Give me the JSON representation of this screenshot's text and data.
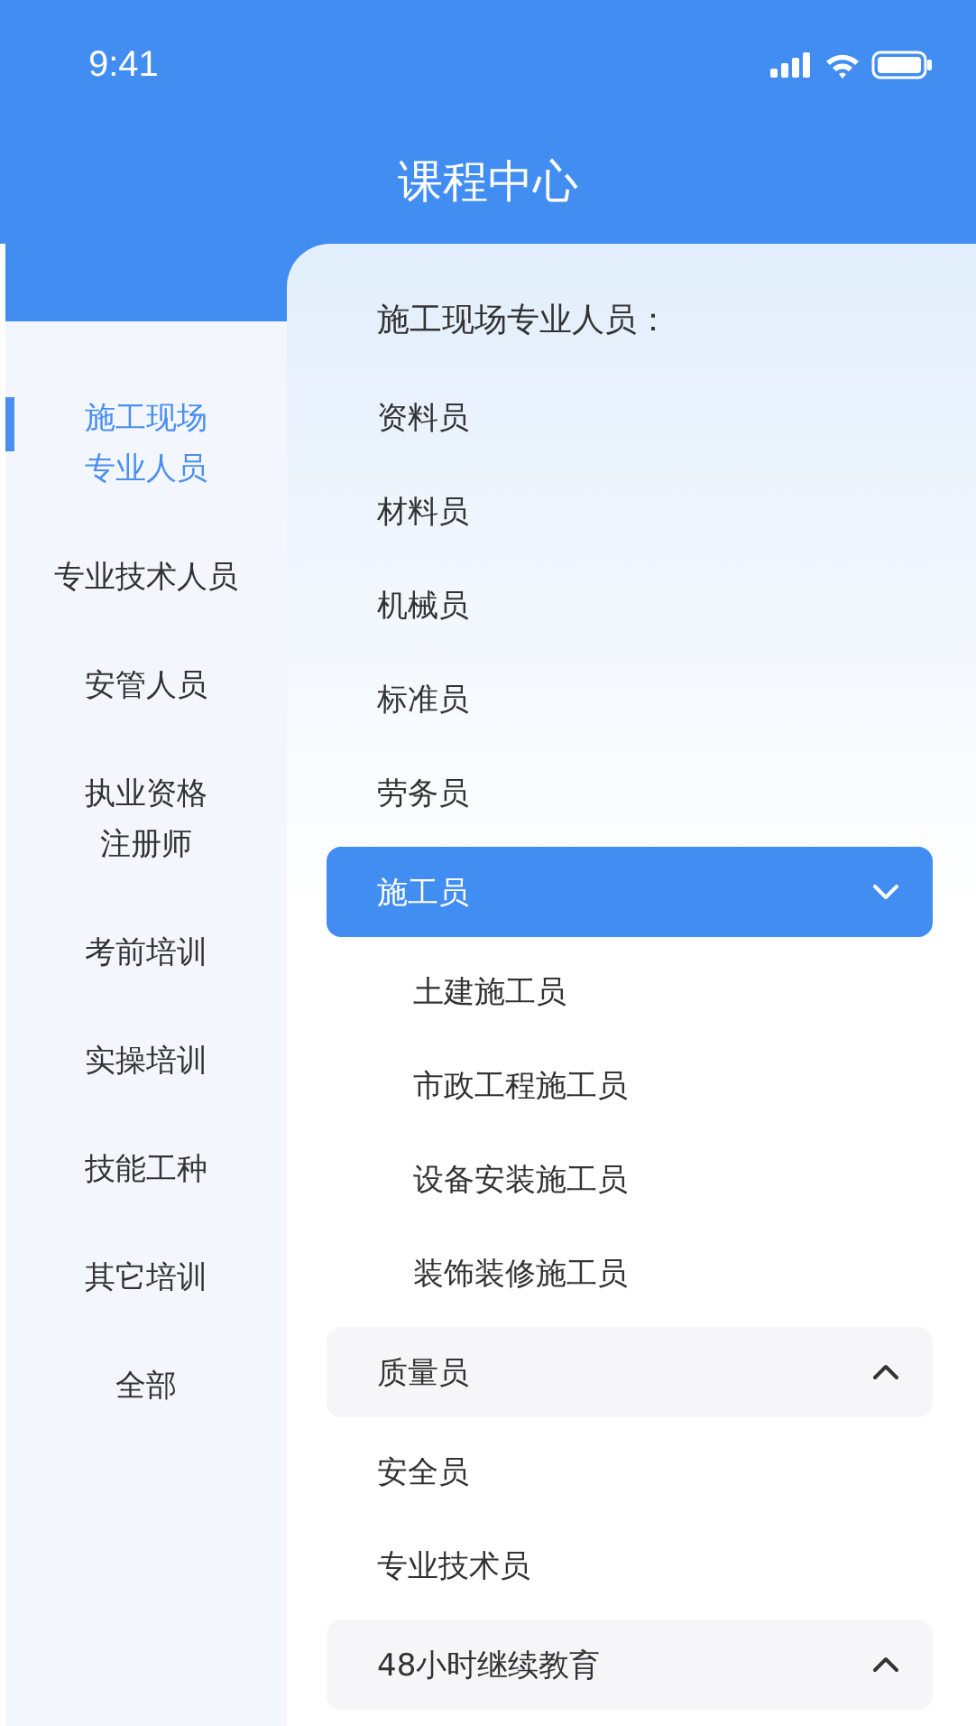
{
  "status_bar": {
    "time": "9:41"
  },
  "header": {
    "title": "课程中心"
  },
  "sidebar": {
    "items": [
      {
        "lines": [
          "施工现场",
          "专业人员"
        ],
        "selected": true
      },
      {
        "lines": [
          "专业技术人员"
        ],
        "selected": false
      },
      {
        "lines": [
          "安管人员"
        ],
        "selected": false
      },
      {
        "lines": [
          "执业资格",
          "注册师"
        ],
        "selected": false
      },
      {
        "lines": [
          "考前培训"
        ],
        "selected": false
      },
      {
        "lines": [
          "实操培训"
        ],
        "selected": false
      },
      {
        "lines": [
          "技能工种"
        ],
        "selected": false
      },
      {
        "lines": [
          "其它培训"
        ],
        "selected": false
      },
      {
        "lines": [
          "全部"
        ],
        "selected": false
      }
    ]
  },
  "content": {
    "section_title": "施工现场专业人员：",
    "items": [
      {
        "kind": "plain",
        "label": "资料员"
      },
      {
        "kind": "plain",
        "label": "材料员"
      },
      {
        "kind": "plain",
        "label": "机械员"
      },
      {
        "kind": "plain",
        "label": "标准员"
      },
      {
        "kind": "plain",
        "label": "劳务员"
      },
      {
        "kind": "group",
        "label": "施工员",
        "selected": true,
        "expanded": true,
        "children": [
          {
            "label": "土建施工员"
          },
          {
            "label": "市政工程施工员"
          },
          {
            "label": "设备安装施工员"
          },
          {
            "label": "装饰装修施工员"
          }
        ]
      },
      {
        "kind": "group",
        "label": "质量员",
        "selected": false,
        "expanded": false
      },
      {
        "kind": "plain",
        "label": "安全员"
      },
      {
        "kind": "plain",
        "label": "专业技术员"
      },
      {
        "kind": "group",
        "label": "48小时继续教育",
        "selected": false,
        "expanded": false
      }
    ]
  }
}
